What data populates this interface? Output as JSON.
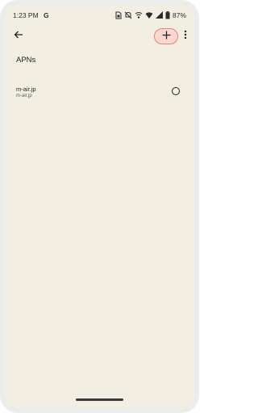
{
  "status_bar": {
    "time": "1:23 PM",
    "g_label": "G",
    "battery": "87%",
    "icons": [
      "sim-card-icon",
      "mute-icon",
      "wifi-call-icon",
      "wifi-icon",
      "signal-icon",
      "battery-icon"
    ]
  },
  "toolbar": {
    "back_icon": "arrow-left-icon",
    "add_icon": "plus-icon",
    "more_icon": "more-vert-icon",
    "add_highlight_color": "#e8836f"
  },
  "page": {
    "title": "APNs"
  },
  "apn_list": [
    {
      "name": "m-air.jp",
      "apn": "m-air.jp",
      "selected": false
    }
  ],
  "colors": {
    "background": "#f2efe2",
    "frame": "#ececec",
    "text": "#1f1f1f"
  }
}
